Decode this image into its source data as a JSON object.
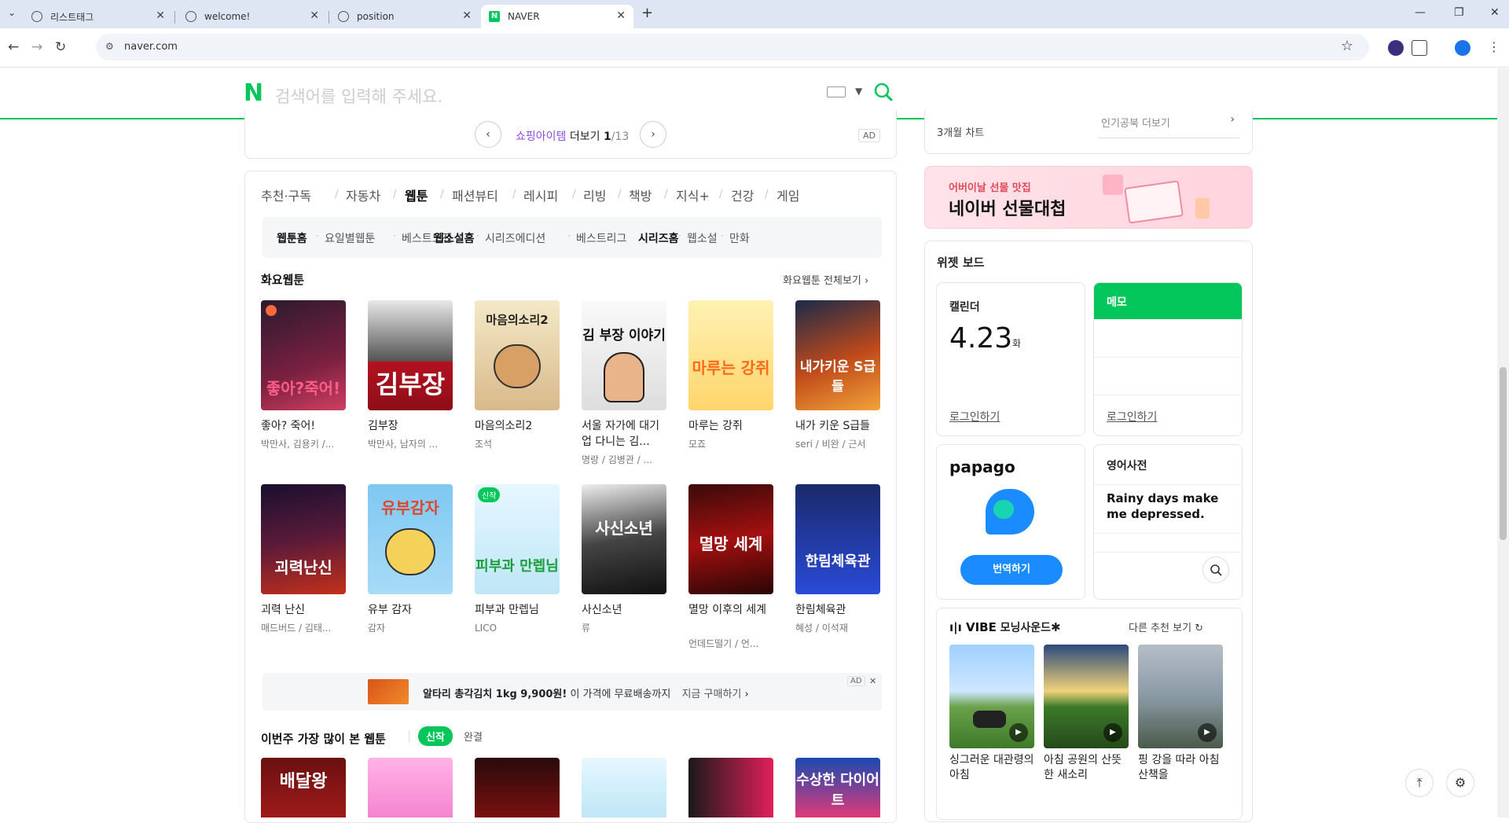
{
  "browser": {
    "tabs": [
      {
        "title": "리스트태그"
      },
      {
        "title": "welcome!"
      },
      {
        "title": "position"
      },
      {
        "title": "NAVER"
      }
    ],
    "new_tab": "+",
    "url": "naver.com"
  },
  "header": {
    "logo": "N",
    "search_placeholder": "검색어를 입력해 주세요."
  },
  "shopping": {
    "label_highlight": "쇼핑아이템",
    "label_rest": "더보기",
    "page_current": "1",
    "page_total": "/13",
    "ad": "AD"
  },
  "categories": [
    "추천·구독",
    "자동차",
    "웹툰",
    "패션뷰티",
    "레시피",
    "리빙",
    "책방",
    "지식+",
    "건강",
    "게임"
  ],
  "subnav": [
    "웹툰홈",
    "요일별웹툰",
    "베스트도전",
    "웹소설홈",
    "시리즈에디션",
    "베스트리그",
    "시리즈홈",
    "웹소설",
    "만화"
  ],
  "tuesday": {
    "title": "화요웹툰",
    "more": "화요웹툰 전체보기",
    "items": [
      {
        "title": "좋아? 죽어!",
        "author": "박만사, 김용키 /...",
        "art": "좋아?죽어!"
      },
      {
        "title": "김부장",
        "author": "박만사, 남자의 ...",
        "art": "김부장"
      },
      {
        "title": "마음의소리2",
        "author": "조석",
        "art": "마음의소리2"
      },
      {
        "title": "서울 자가에 대기업 다니는 김...",
        "author": "명랑 / 김병관 / ...",
        "art": "김 부장 이야기"
      },
      {
        "title": "마루는 강쥐",
        "author": "모죠",
        "art": "마루는 강쥐"
      },
      {
        "title": "내가 키운 S급들",
        "author": "seri / 비완 / 근서",
        "art": "내가키운 S급들"
      },
      {
        "title": "괴력 난신",
        "author": "매드버드 / 김태...",
        "art": "괴력난신"
      },
      {
        "title": "유부 감자",
        "author": "감자",
        "art": "유부감자"
      },
      {
        "title": "피부과 만렙님",
        "author": "LICO",
        "art": "피부과 만렙님"
      },
      {
        "title": "사신소년",
        "author": "류",
        "art": "사신소년"
      },
      {
        "title": "멸망 이후의 세계",
        "author": "언데드떨기 / 언...",
        "art": "멸망 세계"
      },
      {
        "title": "한림체육관",
        "author": "혜성 / 이석재",
        "art": "한림체육관"
      }
    ],
    "new_badge": "신작"
  },
  "ad_strip": {
    "headline": "알타리 총각김치 1kg 9,900원!",
    "sub": "이 가격에 무료배송까지",
    "cta": "지금 구매하기",
    "ad": "AD",
    "close": "✕"
  },
  "popular": {
    "title": "이번주 가장 많이 본 웹툰",
    "tab_new": "신작",
    "tab_done": "완결",
    "arts": [
      "배달왕",
      "",
      "",
      "",
      "",
      "수상한 다이어트"
    ]
  },
  "right": {
    "chart_label": "3개월 차트",
    "chart_more": "인기공북 더보기",
    "gift": {
      "line1": "어버이날 선물 맛집",
      "line2": "네이버 선물대첩"
    },
    "widget_title": "위젯 보드",
    "calendar": {
      "title": "캘린더",
      "date": "4.23",
      "day": "화",
      "login": "로그인하기"
    },
    "memo": {
      "title": "메모",
      "login": "로그인하기"
    },
    "papago": {
      "logo": "papago",
      "button": "번역하기"
    },
    "dict": {
      "title": "영어사전",
      "sentence": "Rainy days make me depressed."
    },
    "vibe": {
      "logo": "VIBE",
      "title": "모닝사운드",
      "more": "다른 추천 보기",
      "items": [
        {
          "title": "싱그러운 대관령의 아침"
        },
        {
          "title": "아침 공원의 산뜻한 새소리"
        },
        {
          "title": "핑 강을 따라 아침 산책을"
        }
      ]
    }
  },
  "colors": {
    "naver_green": "#03c75a",
    "accent_purple": "#8d4ddf"
  }
}
